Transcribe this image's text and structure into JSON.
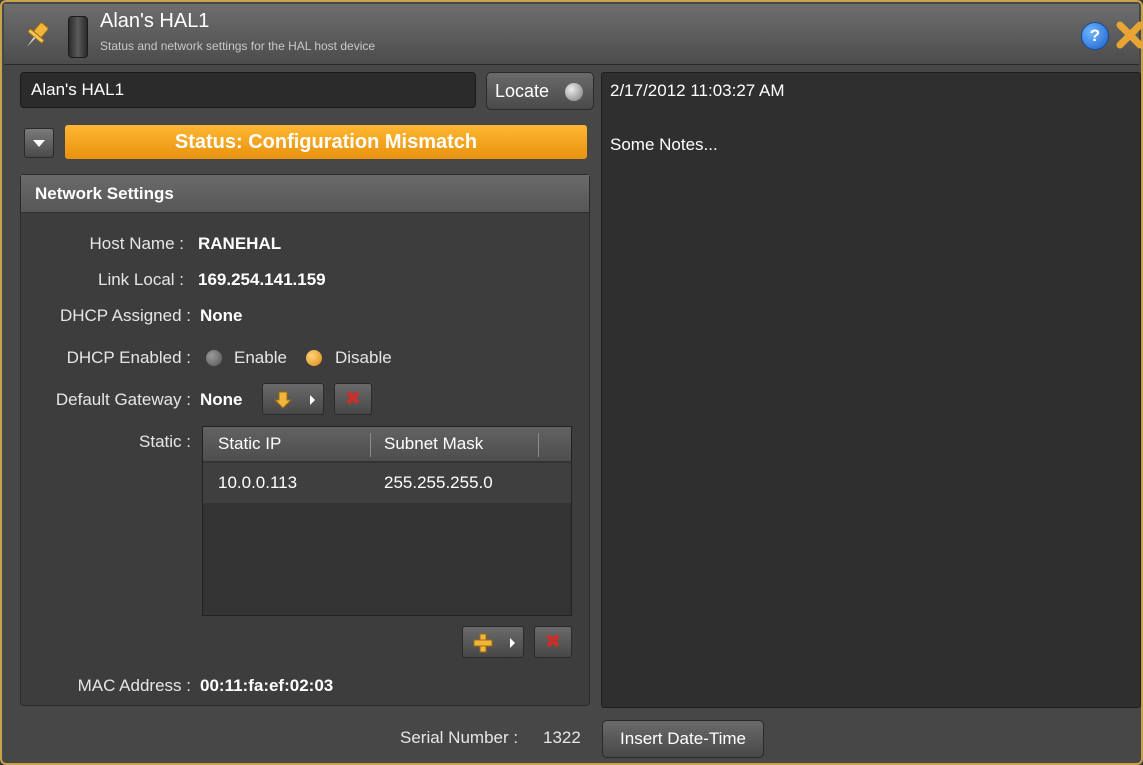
{
  "window": {
    "title": "Alan's HAL1",
    "subtitle": "Status and network settings for the HAL host device",
    "icons": [
      "pin-icon",
      "device-icon",
      "help-icon",
      "close-icon"
    ]
  },
  "device": {
    "name_value": "Alan's HAL1",
    "locate_label": "Locate",
    "status_text": "Status:  Configuration Mismatch"
  },
  "network": {
    "header": "Network Settings",
    "host_name_label": "Host Name :",
    "host_name_value": "RANEHAL",
    "link_local_label": "Link Local :",
    "link_local_value": "169.254.141.159",
    "dhcp_assigned_label": "DHCP Assigned :",
    "dhcp_assigned_value": "None",
    "dhcp_enabled_label": "DHCP Enabled :",
    "dhcp_enable_option": "Enable",
    "dhcp_disable_option": "Disable",
    "dhcp_selected": "Disable",
    "gateway_label": "Default Gateway :",
    "gateway_value": "None",
    "static_label": "Static :",
    "static_columns": [
      "Static IP",
      "Subnet Mask"
    ],
    "static_rows": [
      {
        "ip": "10.0.0.113",
        "mask": "255.255.255.0"
      }
    ],
    "mac_label": "MAC Address :",
    "mac_value": "00:11:fa:ef:02:03"
  },
  "notes": {
    "timestamp": "2/17/2012 11:03:27 AM",
    "text": "Some Notes..."
  },
  "footer": {
    "serial_label": "Serial Number :",
    "serial_value": "1322",
    "insert_button": "Insert Date-Time"
  },
  "colors": {
    "status_orange": "#f5a623",
    "accent_border": "#c9a24a",
    "delete_red": "#c9302c"
  }
}
